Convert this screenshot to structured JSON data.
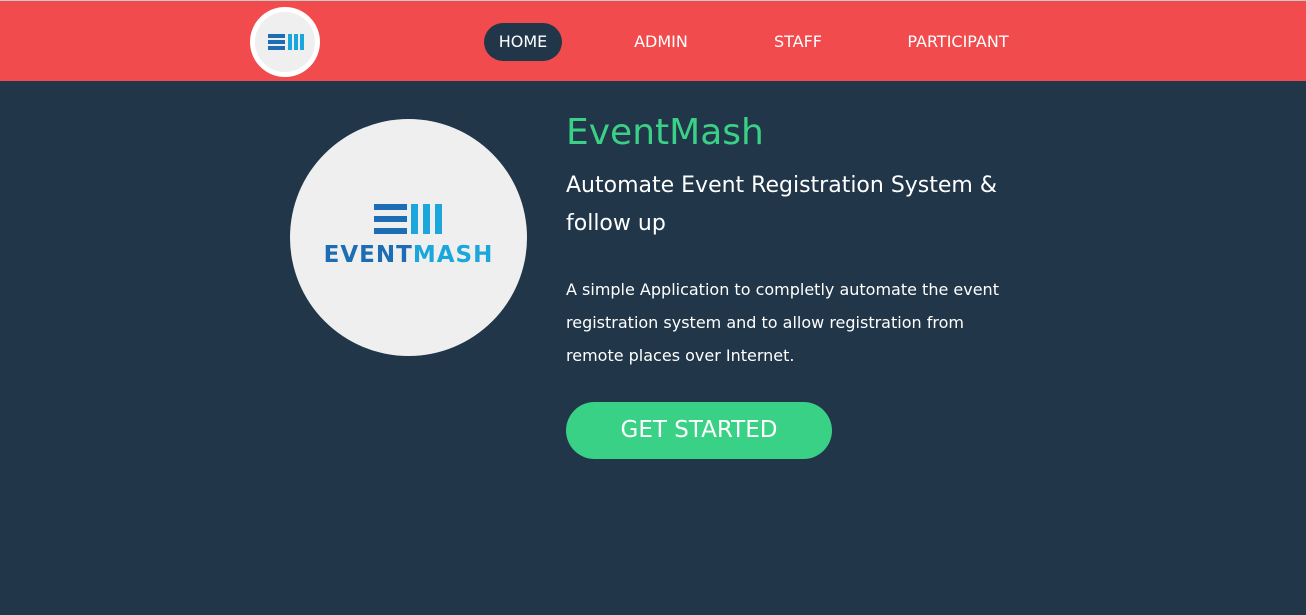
{
  "nav": {
    "items": [
      {
        "label": "HOME",
        "active": true
      },
      {
        "label": "ADMIN",
        "active": false
      },
      {
        "label": "STAFF",
        "active": false
      },
      {
        "label": "PARTICIPANT",
        "active": false
      }
    ]
  },
  "logo": {
    "icon": "eventmash-logo-icon",
    "wordmark_part1": "EVENT",
    "wordmark_part2": "MASH"
  },
  "hero": {
    "title": "EventMash",
    "subtitle": "Automate Event Registration System & follow up",
    "description": "A simple Application to completly automate the event registration system and to allow registration from remote places over Internet.",
    "cta_label": "GET STARTED"
  },
  "colors": {
    "navbar": "#f24b4d",
    "background": "#213649",
    "accent": "#3ad187",
    "logo_dark_blue": "#1c6db3",
    "logo_light_blue": "#1ba7dc"
  }
}
